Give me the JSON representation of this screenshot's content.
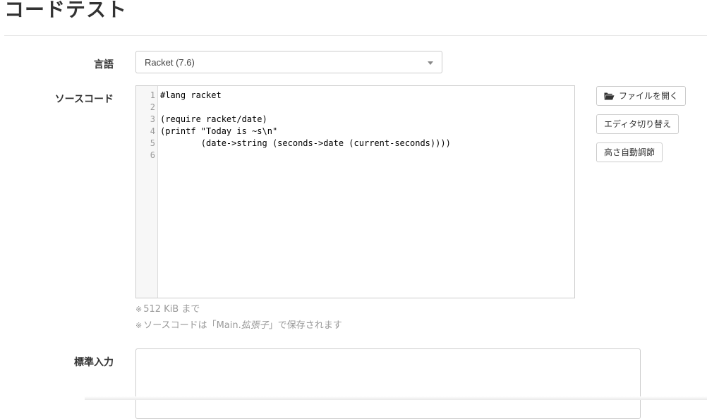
{
  "page": {
    "title": "コードテスト"
  },
  "form": {
    "language_label": "言語",
    "language_selected": "Racket (7.6)",
    "source_label": "ソースコード",
    "stdin_label": "標準入力"
  },
  "editor": {
    "line_numbers": [
      "1",
      "2",
      "3",
      "4",
      "5",
      "6"
    ],
    "lines": [
      "#lang racket",
      "",
      "(require racket/date)",
      "(printf \"Today is ~s\\n\"",
      "        (date->string (seconds->date (current-seconds))))",
      ""
    ]
  },
  "buttons": {
    "open_file": "ファイルを開く",
    "toggle_editor": "エディタ切り替え",
    "auto_height": "高さ自動調節"
  },
  "notes": {
    "mark": "※",
    "size_limit": "512 KiB まで",
    "save_prefix": "ソースコードは「Main.",
    "save_ext": "拡張子",
    "save_suffix": "」で保存されます"
  },
  "icons": {
    "open_file_icon": "folder-open-icon",
    "select_arrow_icon": "caret-down-icon"
  }
}
